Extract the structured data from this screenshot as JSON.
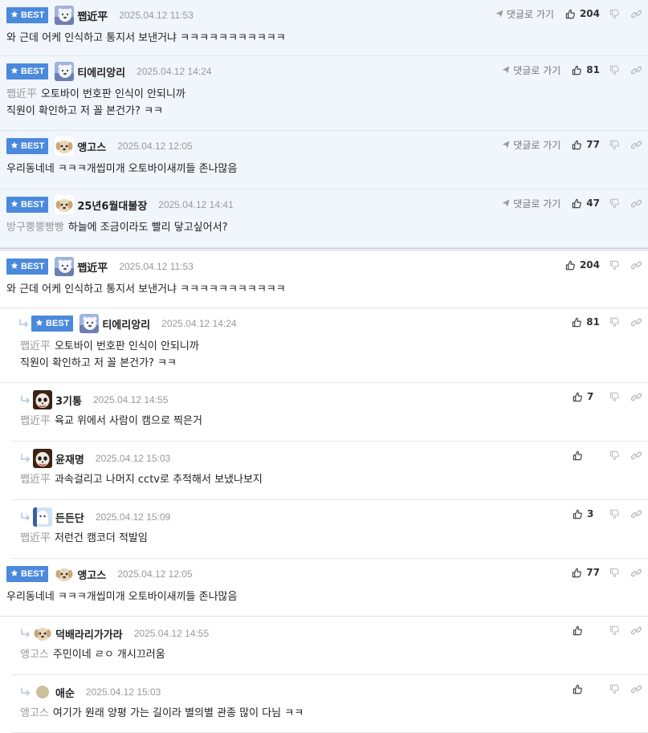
{
  "best_label": "BEST",
  "goto_label": "댓글로 가기",
  "best_comments": [
    {
      "nick": "쨉近平",
      "date": "2025.04.12 11:53",
      "likes": "204",
      "avatar": "polar",
      "lines": [
        {
          "mention": "",
          "text": "와 근데 어케 인식하고 통지서 보낸거냐 ㅋㅋㅋㅋㅋㅋㅋㅋㅋㅋㅋ"
        }
      ]
    },
    {
      "nick": "티에리앙리",
      "date": "2025.04.12 14:24",
      "likes": "81",
      "avatar": "polar",
      "lines": [
        {
          "mention": "쨉近平",
          "text": "오토바이 번호판 인식이 안되니까"
        },
        {
          "mention": "",
          "text": "직원이 확인하고 저 꼴 본건가? ㅋㅋ"
        }
      ]
    },
    {
      "nick": "앵고스",
      "date": "2025.04.12 12:05",
      "likes": "77",
      "avatar": "dog",
      "lines": [
        {
          "mention": "",
          "text": "우리동네네 ㅋㅋㅋ개씹미개 오토바이새끼들 존나많음"
        }
      ]
    },
    {
      "nick": "25년6월대불장",
      "date": "2025.04.12 14:41",
      "likes": "47",
      "avatar": "dog",
      "lines": [
        {
          "mention": "방구뿡뿡빵빵",
          "text": "하늘에 조금이라도 빨리 닿고싶어서?"
        }
      ]
    }
  ],
  "comments": [
    {
      "nick": "쨉近平",
      "date": "2025.04.12 11:53",
      "likes": "204",
      "avatar": "polar",
      "best": true,
      "reply": false,
      "lines": [
        {
          "mention": "",
          "text": "와 근데 어케 인식하고 통지서 보낸거냐 ㅋㅋㅋㅋㅋㅋㅋㅋㅋㅋㅋ"
        }
      ]
    },
    {
      "nick": "티에리앙리",
      "date": "2025.04.12 14:24",
      "likes": "81",
      "avatar": "polar",
      "best": true,
      "reply": true,
      "lines": [
        {
          "mention": "쨉近平",
          "text": "오토바이 번호판 인식이 안되니까"
        },
        {
          "mention": "",
          "text": "직원이 확인하고 저 꼴 본건가? ㅋㅋ"
        }
      ]
    },
    {
      "nick": "3기통",
      "date": "2025.04.12 14:55",
      "likes": "7",
      "avatar": "face",
      "best": false,
      "reply": true,
      "lines": [
        {
          "mention": "쨉近平",
          "text": "육교 위에서 사람이 캠으로 찍은거"
        }
      ]
    },
    {
      "nick": "윤재명",
      "date": "2025.04.12 15:03",
      "likes": "",
      "avatar": "face",
      "best": false,
      "reply": true,
      "lines": [
        {
          "mention": "쨉近平",
          "text": "과속걸리고 나머지 cctv로 추적해서 보냈나보지"
        }
      ]
    },
    {
      "nick": "든든단",
      "date": "2025.04.12 15:09",
      "likes": "3",
      "avatar": "ghost",
      "best": false,
      "reply": true,
      "lines": [
        {
          "mention": "쨉近平",
          "text": "저런건 캠코더 적발임"
        }
      ]
    },
    {
      "nick": "앵고스",
      "date": "2025.04.12 12:05",
      "likes": "77",
      "avatar": "dog",
      "best": true,
      "reply": false,
      "lines": [
        {
          "mention": "",
          "text": "우리동네네 ㅋㅋㅋ개씹미개 오토바이새끼들 존나많음"
        }
      ]
    },
    {
      "nick": "덕배라리가가라",
      "date": "2025.04.12 14:55",
      "likes": "",
      "avatar": "dog",
      "best": false,
      "reply": true,
      "lines": [
        {
          "mention": "앵고스",
          "text": "주민이네 ㄹㅇ 개시끄러움"
        }
      ]
    },
    {
      "nick": "애순",
      "date": "2025.04.12 15:03",
      "likes": "",
      "avatar": "circle",
      "best": false,
      "reply": true,
      "lines": [
        {
          "mention": "앵고스",
          "text": "여기가 원래 양평 가는 길이라 별의별 관종 많이 다님 ㅋㅋ"
        }
      ]
    }
  ]
}
